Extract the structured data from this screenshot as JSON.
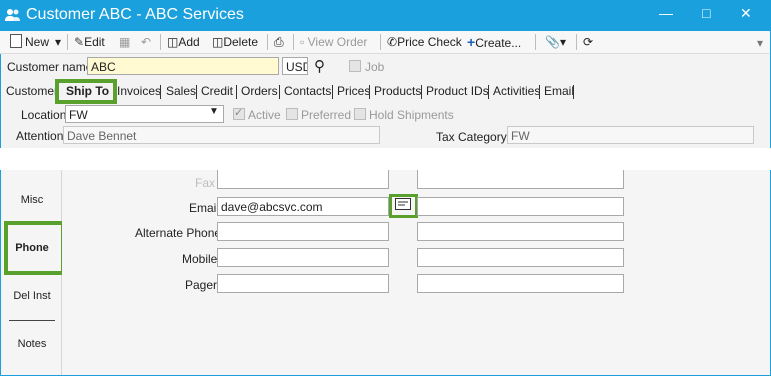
{
  "window": {
    "title": "Customer ABC - ABC Services"
  },
  "toolbar": {
    "new": "New",
    "edit": "Edit",
    "add": "Add",
    "delete": "Delete",
    "view_order": "View Order",
    "price_check": "Price Check",
    "create": "Create..."
  },
  "customer": {
    "name_label": "Customer name",
    "name_value": "ABC",
    "currency": "USD",
    "job_label": "Job"
  },
  "tabs": [
    "Customer",
    "Ship To",
    "Invoices",
    "Sales",
    "Credit",
    "Orders",
    "Contacts",
    "Prices",
    "Products",
    "Product IDs",
    "Activities",
    "Email"
  ],
  "active_tab": "Ship To",
  "shipto": {
    "location_label": "Location",
    "location_value": "FW",
    "active_label": "Active",
    "preferred_label": "Preferred",
    "hold_label": "Hold Shipments",
    "attention_label": "Attention",
    "attention_value": "Dave Bennet",
    "taxcat_label": "Tax Category",
    "taxcat_value": "FW"
  },
  "sidebar": {
    "items": [
      "Misc",
      "Phone",
      "Del Inst",
      "Notes"
    ],
    "selected": "Phone"
  },
  "phone": {
    "fax_label": "Fax",
    "email_label": "Email",
    "email_value": "dave@abcsvc.com",
    "alternate_label": "Alternate Phone",
    "mobile_label": "Mobile",
    "pager_label": "Pager"
  },
  "colors": {
    "titlebar": "#1aa0dc",
    "highlight": "#5aa02c",
    "accent_link": "#1a5fb4"
  }
}
